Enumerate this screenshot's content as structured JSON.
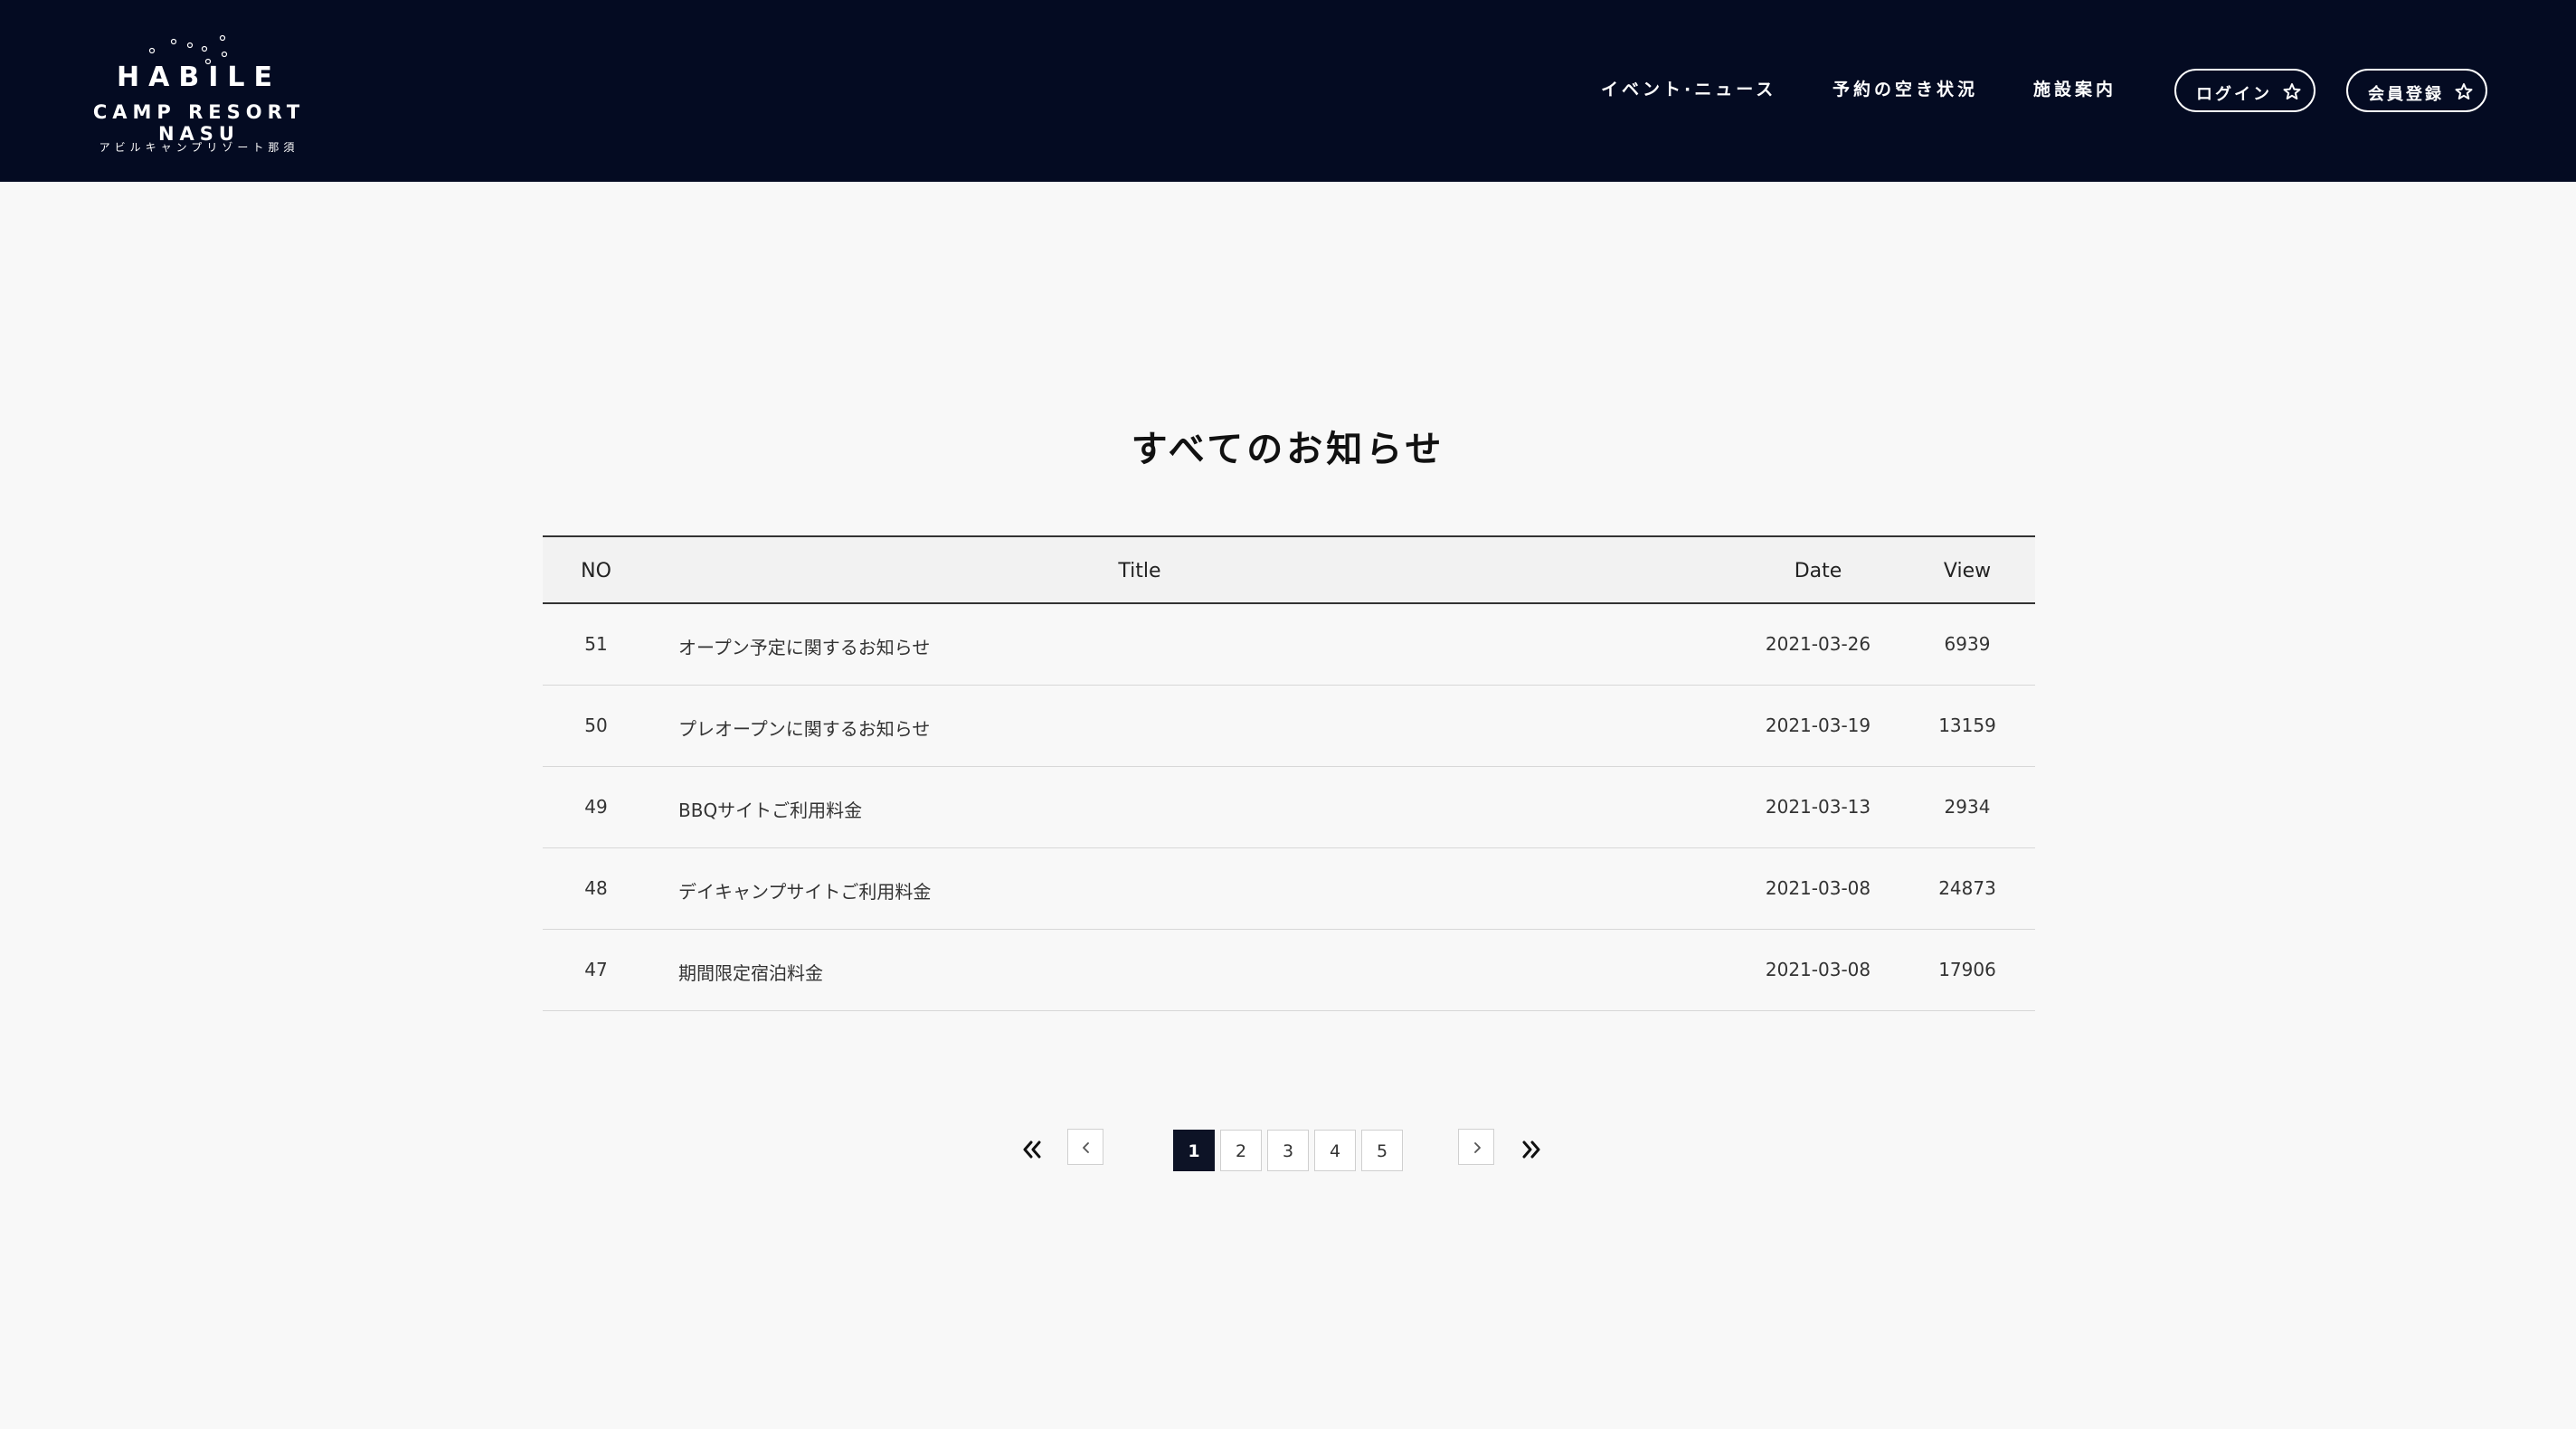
{
  "header": {
    "logo": {
      "line1": "HABILE",
      "line2": "CAMP RESORT NASU",
      "line3": "アビルキャンプリゾート那須"
    },
    "nav": [
      {
        "label": "イベント·ニュース"
      },
      {
        "label": "予約の空き状況"
      },
      {
        "label": "施設案内"
      }
    ],
    "login_label": "ログイン",
    "register_label": "会員登録",
    "background_color": "#040b22"
  },
  "page": {
    "title": "すべてのお知らせ"
  },
  "table": {
    "columns": {
      "no": "NO",
      "title": "Title",
      "date": "Date",
      "view": "View"
    },
    "rows": [
      {
        "no": "51",
        "title": "オープン予定に関するお知らせ",
        "date": "2021-03-26",
        "view": "6939"
      },
      {
        "no": "50",
        "title": "プレオープンに関するお知らせ",
        "date": "2021-03-19",
        "view": "13159"
      },
      {
        "no": "49",
        "title": "BBQサイトご利用料金",
        "date": "2021-03-13",
        "view": "2934"
      },
      {
        "no": "48",
        "title": "デイキャンプサイトご利用料金",
        "date": "2021-03-08",
        "view": "24873"
      },
      {
        "no": "47",
        "title": "期間限定宿泊料金",
        "date": "2021-03-08",
        "view": "17906"
      }
    ]
  },
  "pagination": {
    "pages": [
      "1",
      "2",
      "3",
      "4",
      "5"
    ],
    "current": "1",
    "active_color": "#0d1326",
    "icons": {
      "first": "double-chevron-left-icon",
      "prev": "chevron-left-icon",
      "next": "chevron-right-icon",
      "last": "double-chevron-right-icon"
    }
  }
}
